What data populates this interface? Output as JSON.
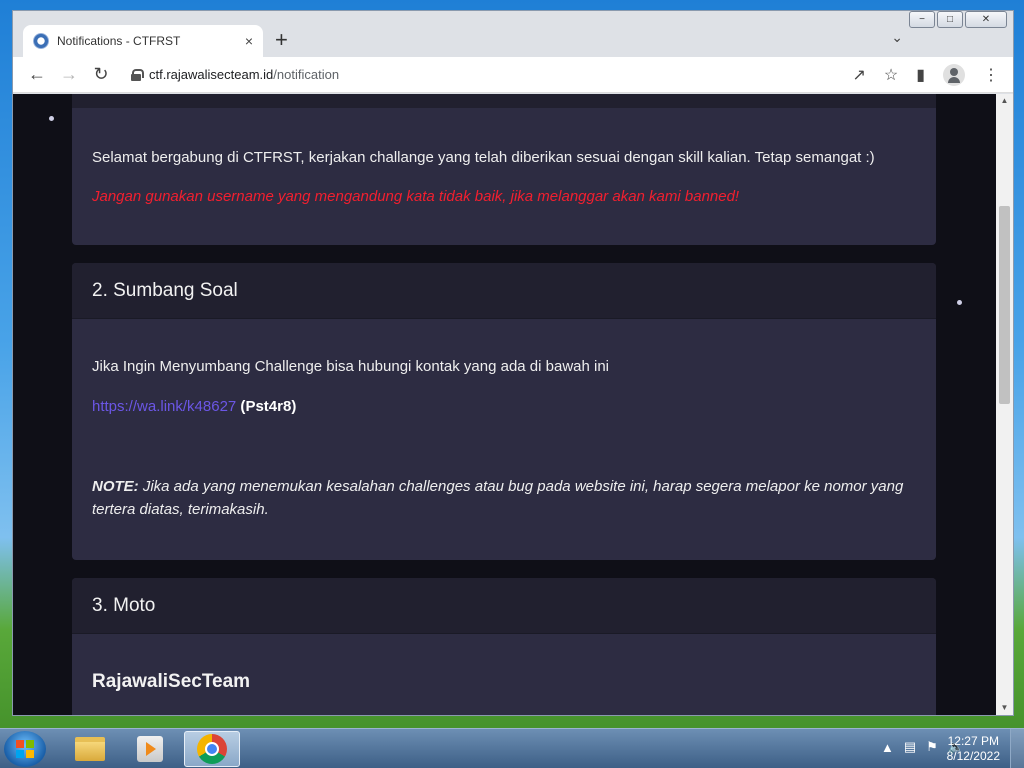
{
  "browser": {
    "tab_title": "Notifications - CTFRST",
    "tab_close": "×",
    "new_tab": "+",
    "tab_menu": "⌄",
    "url_domain": "ctf.rajawalisecteam.id",
    "url_path": "/notification",
    "win_minimize": "−",
    "win_maximize": "□",
    "win_close": "✕"
  },
  "page": {
    "card1": {
      "welcome": "Selamat bergabung di CTFRST, kerjakan challange yang telah diberikan sesuai dengan skill kalian. Tetap semangat :)",
      "warning": "Jangan gunakan username yang mengandung kata tidak baik, jika melanggar akan kami banned!"
    },
    "card2": {
      "title": "2. Sumbang Soal",
      "intro": "Jika Ingin Menyumbang Challenge bisa hubungi kontak yang ada di bawah ini",
      "link": "https://wa.link/k48627",
      "paren_open": " (",
      "contact_name": "Pst4r8",
      "paren_close": ")",
      "note_label": "NOTE:",
      "note_text": " Jika ada yang menemukan kesalahan challenges atau bug pada website ini, harap segera melapor ke nomor yang tertera diatas, terimakasih."
    },
    "card3": {
      "title": "3. Moto",
      "motto": "RajawaliSecTeam"
    }
  },
  "taskbar": {
    "tray_arrow": "▲",
    "time": "12:27 PM",
    "date": "8/12/2022"
  }
}
